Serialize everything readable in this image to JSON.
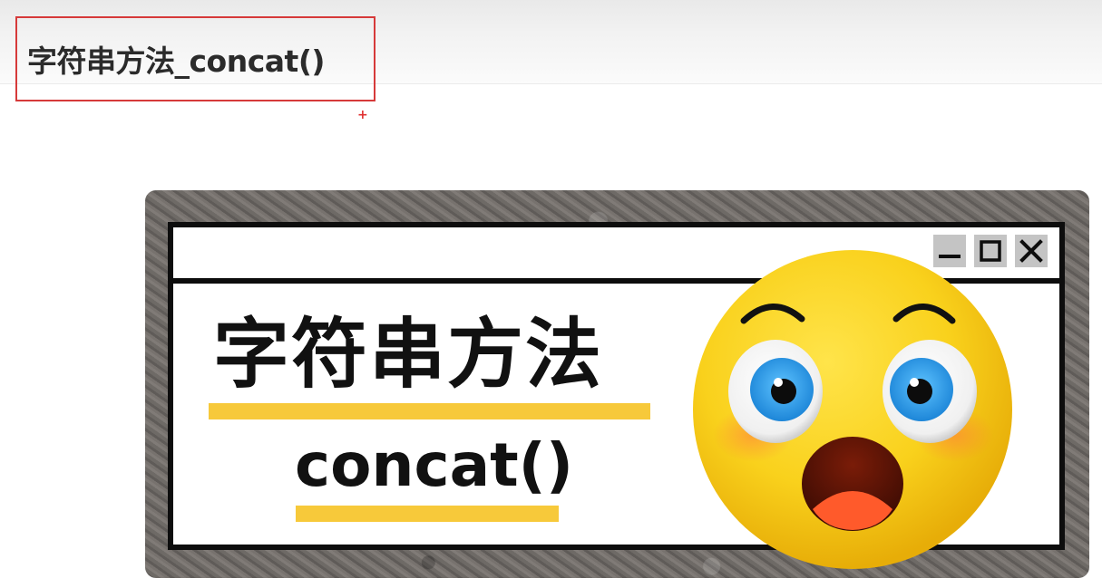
{
  "header": {
    "title": "字符串方法_concat()",
    "highlight_color": "#d63a3a",
    "cursor_mark": "+"
  },
  "thumbnail": {
    "heading": "字符串方法",
    "method": "concat()",
    "accent_color": "#f7c93a",
    "emoji": "surprised-face",
    "window_controls": [
      "minimize-icon",
      "maximize-icon",
      "close-icon"
    ]
  }
}
